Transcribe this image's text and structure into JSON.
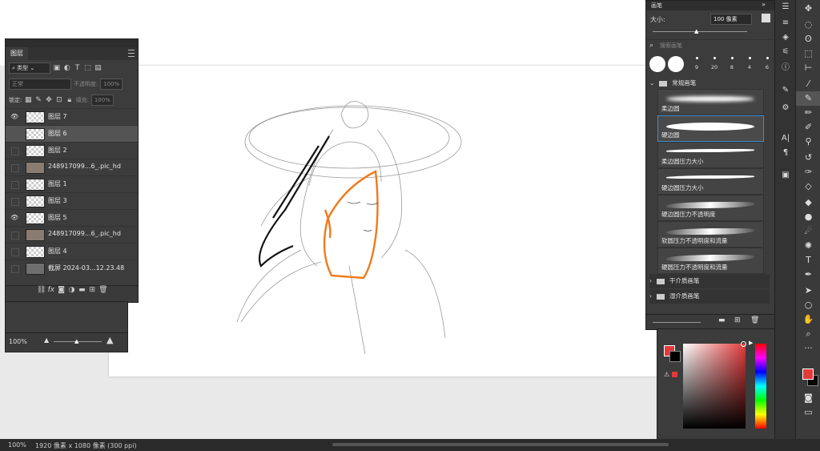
{
  "layers_panel": {
    "tab": "图层",
    "filter_label": "类型",
    "blend_mode": "正常",
    "opacity_label": "不透明度:",
    "opacity_value": "100%",
    "lock_label": "锁定:",
    "fill_label": "填充:",
    "fill_value": "100%",
    "layers": [
      {
        "name": "图层 7",
        "visible": true,
        "thumb": "blank"
      },
      {
        "name": "图层 6",
        "visible": false,
        "thumb": "blank",
        "selected": true
      },
      {
        "name": "图层 2",
        "visible": false,
        "thumb": "blank"
      },
      {
        "name": "248917099...6_.pic_hd",
        "visible": false,
        "thumb": "img"
      },
      {
        "name": "图层 1",
        "visible": false,
        "thumb": "blank"
      },
      {
        "name": "图层 3",
        "visible": false,
        "thumb": "blank"
      },
      {
        "name": "图层 5",
        "visible": true,
        "thumb": "blank"
      },
      {
        "name": "248917099...6_.pic_hd",
        "visible": false,
        "thumb": "img"
      },
      {
        "name": "图层 4",
        "visible": false,
        "thumb": "blank"
      },
      {
        "name": "截屏 2024-03...12.23.48",
        "visible": false,
        "thumb": "shot"
      }
    ]
  },
  "zoom_panel": {
    "zoom": "100%"
  },
  "brush_panel": {
    "title": "画笔",
    "size_label": "大小:",
    "size_value": "100 像素",
    "search_placeholder": "搜索画笔",
    "recent_sizes": [
      "9",
      "20",
      "8",
      "4",
      "6"
    ],
    "open_folder": "常规画笔",
    "brushes": [
      "柔边圆",
      "硬边圆",
      "柔边圆压力大小",
      "硬边圆压力大小",
      "硬边圆压力不透明度",
      "软圆压力不透明度和流量",
      "硬圆压力不透明度和流量"
    ],
    "folders": [
      "干介质画笔",
      "湿介质画笔"
    ]
  },
  "color_panel": {
    "foreground": "#e23a3a",
    "background": "#000000"
  },
  "status": {
    "zoom": "100%",
    "doc_info": "1920 像素 x 1080 像素 (300 ppi)"
  },
  "accent": {
    "sketch_orange": "#f07a1a",
    "selection_blue": "#3e8ed0"
  }
}
